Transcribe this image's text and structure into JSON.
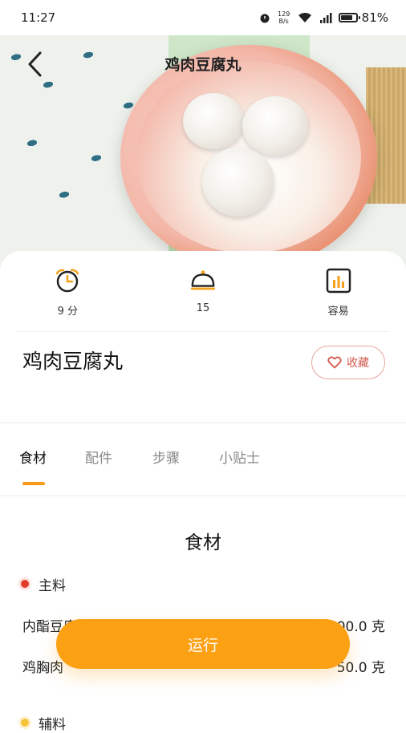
{
  "status_bar": {
    "time": "11:27",
    "net_speed_top": "129",
    "net_speed_bottom": "B/s",
    "battery_percent": "81%",
    "battery_level": 0.81
  },
  "header": {
    "title": "鸡肉豆腐丸",
    "back_icon": "chevron-left-icon"
  },
  "stats": [
    {
      "icon": "alarm-clock-icon",
      "label": "9 分"
    },
    {
      "icon": "serving-dome-icon",
      "label": "15"
    },
    {
      "icon": "bar-chart-icon",
      "label": "容易"
    }
  ],
  "recipe": {
    "title": "鸡肉豆腐丸",
    "favorite_label": "收藏"
  },
  "tabs": [
    {
      "label": "食材",
      "active": true
    },
    {
      "label": "配件",
      "active": false
    },
    {
      "label": "步骤",
      "active": false
    },
    {
      "label": "小贴士",
      "active": false
    }
  ],
  "ingredients": {
    "heading": "食材",
    "main_group": "主料",
    "main_items": [
      {
        "name": "内酯豆腐",
        "amount": "100.0 克"
      },
      {
        "name": "鸡胸肉",
        "amount": "50.0 克"
      }
    ],
    "secondary_group": "辅料"
  },
  "run_button": {
    "label": "运行"
  },
  "colors": {
    "accent": "#fca014",
    "tab_indicator": "#f89b1a",
    "favorite": "#d2584c"
  }
}
